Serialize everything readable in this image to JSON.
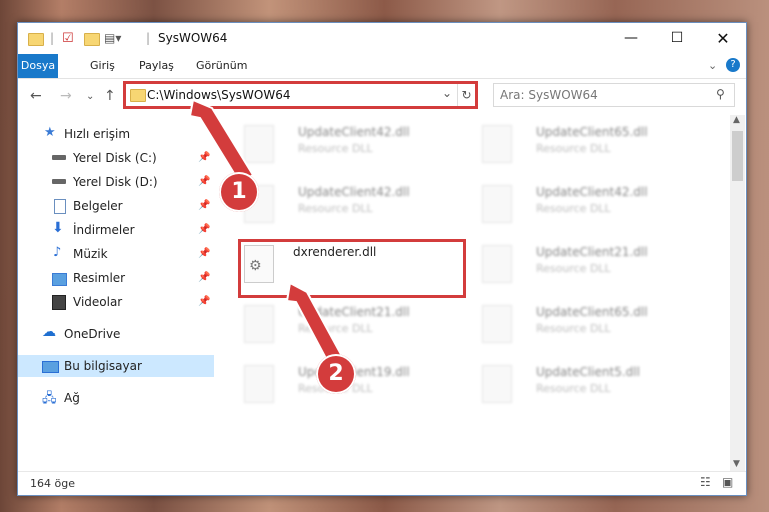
{
  "window": {
    "title": "SysWOW64"
  },
  "ribbon": {
    "tabs": [
      "Dosya",
      "Giriş",
      "Paylaş",
      "Görünüm"
    ]
  },
  "address": {
    "path": "C:\\Windows\\SysWOW64"
  },
  "search": {
    "placeholder": "Ara: SysWOW64"
  },
  "sidebar": {
    "items": [
      {
        "label": "Hızlı erişim",
        "icon": "star-icon"
      },
      {
        "label": "Yerel Disk (C:)",
        "icon": "drive-icon",
        "pinned": true
      },
      {
        "label": "Yerel Disk (D:)",
        "icon": "drive-icon",
        "pinned": true
      },
      {
        "label": "Belgeler",
        "icon": "document-icon",
        "pinned": true
      },
      {
        "label": "İndirmeler",
        "icon": "download-icon",
        "pinned": true
      },
      {
        "label": "Müzik",
        "icon": "music-icon",
        "pinned": true
      },
      {
        "label": "Resimler",
        "icon": "picture-icon",
        "pinned": true
      },
      {
        "label": "Videolar",
        "icon": "video-icon",
        "pinned": true
      },
      {
        "label": "OneDrive",
        "icon": "cloud-icon"
      },
      {
        "label": "Bu bilgisayar",
        "icon": "computer-icon",
        "selected": true
      },
      {
        "label": "Ağ",
        "icon": "network-icon"
      }
    ]
  },
  "files": [
    {
      "name": "UpdateClient42.dll",
      "type": "Resource DLL"
    },
    {
      "name": "UpdateClient65.dll",
      "type": "Resource DLL"
    },
    {
      "name": "UpdateClient42.dll",
      "type": "Resource DLL"
    },
    {
      "name": "UpdateClient42.dll",
      "type": "Resource DLL"
    },
    {
      "name": "dxrenderer.dll",
      "type": ""
    },
    {
      "name": "UpdateClient21.dll",
      "type": "Resource DLL"
    },
    {
      "name": "UpdateClient21.dll",
      "type": "Resource DLL"
    },
    {
      "name": "UpdateClient65.dll",
      "type": "Resource DLL"
    },
    {
      "name": "UpdateClient19.dll",
      "type": "Resource DLL"
    },
    {
      "name": "UpdateClient5.dll",
      "type": "Resource DLL"
    }
  ],
  "status": {
    "count": "164 öge"
  },
  "annotations": {
    "step1": "1",
    "step2": "2"
  },
  "colors": {
    "accent": "#1979ca",
    "highlight": "#d33c3c"
  }
}
